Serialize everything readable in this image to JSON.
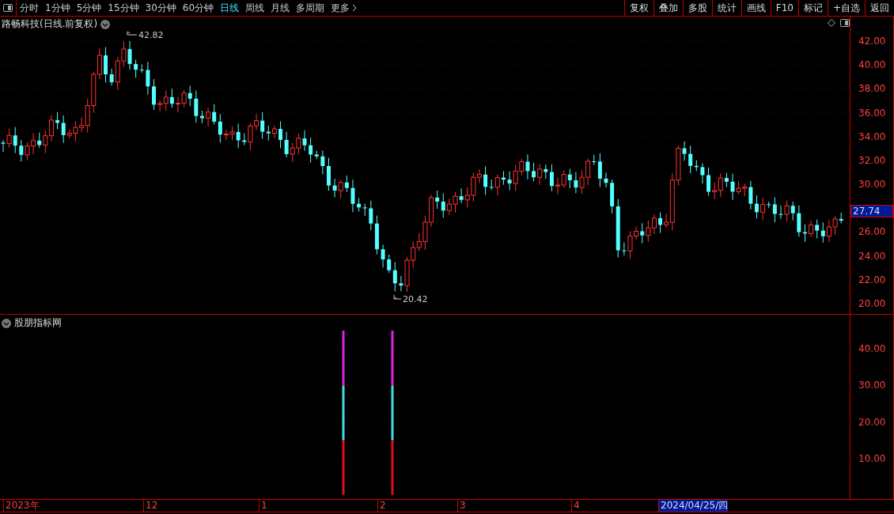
{
  "toolbar": {
    "periods": [
      {
        "label": "分时",
        "selected": false
      },
      {
        "label": "1分钟",
        "selected": false
      },
      {
        "label": "5分钟",
        "selected": false
      },
      {
        "label": "15分钟",
        "selected": false
      },
      {
        "label": "30分钟",
        "selected": false
      },
      {
        "label": "60分钟",
        "selected": false
      },
      {
        "label": "日线",
        "selected": true
      },
      {
        "label": "周线",
        "selected": false
      },
      {
        "label": "月线",
        "selected": false
      },
      {
        "label": "多周期",
        "selected": false
      }
    ],
    "more": "更多",
    "actions": [
      "复权",
      "叠加",
      "多股",
      "统计",
      "画线",
      "F10",
      "标记",
      "+自选",
      "返回"
    ]
  },
  "main_chart": {
    "title": "路畅科技(日线.前复权)",
    "high_label": "42.82",
    "low_label": "20.42",
    "y_ticks": [
      "42.00",
      "40.00",
      "38.00",
      "36.00",
      "34.00",
      "32.00",
      "30.00",
      "26.00",
      "24.00",
      "22.00",
      "20.00"
    ],
    "last_price": "27.74"
  },
  "indicator": {
    "title": "股朋指标网",
    "y_ticks": [
      "40.00",
      "30.00",
      "20.00",
      "10.00"
    ]
  },
  "date_axis": [
    {
      "label": "2023年",
      "selected": false
    },
    {
      "label": "12",
      "selected": false
    },
    {
      "label": "1",
      "selected": false
    },
    {
      "label": "2",
      "selected": false
    },
    {
      "label": "3",
      "selected": false
    },
    {
      "label": "4",
      "selected": false
    },
    {
      "label": "2024/04/25/四",
      "selected": true
    }
  ]
}
